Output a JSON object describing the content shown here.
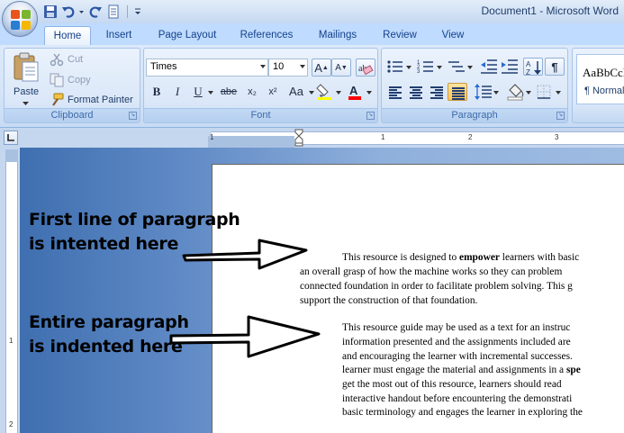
{
  "window": {
    "title": "Document1 - Microsoft Word"
  },
  "tabs": [
    {
      "label": "Home"
    },
    {
      "label": "Insert"
    },
    {
      "label": "Page Layout"
    },
    {
      "label": "References"
    },
    {
      "label": "Mailings"
    },
    {
      "label": "Review"
    },
    {
      "label": "View"
    }
  ],
  "clipboard": {
    "paste_label": "Paste",
    "cut_label": "Cut",
    "copy_label": "Copy",
    "format_painter_label": "Format Painter",
    "group_label": "Clipboard"
  },
  "font": {
    "family": "Times",
    "size": "10",
    "group_label": "Font",
    "bold": "B",
    "italic": "I",
    "underline": "U",
    "strike": "abe",
    "subscript": "x₂",
    "superscript": "x²",
    "change_case": "Aa",
    "grow": "A",
    "shrink": "A"
  },
  "paragraph": {
    "group_label": "Paragraph",
    "sort": "A↓",
    "show_marks": "¶"
  },
  "styles": {
    "preview": "AaBbCcI",
    "normal_label": "¶ Normal"
  },
  "ruler": {
    "marks": [
      "1",
      "1",
      "2",
      "3"
    ]
  },
  "vruler": {
    "marks": [
      "1",
      "2"
    ]
  },
  "callouts": {
    "first_line_1": "First line of paragraph",
    "first_line_2": "is intented here",
    "entire_1": "Entire paragraph",
    "entire_2": "is indented here"
  },
  "document": {
    "para1": {
      "line1_pre": "This resource is designed to ",
      "line1_bold": "empower",
      "line1_post": " learners with basic",
      "line2": "an overall grasp of how the machine works so they can problem",
      "line3": "connected foundation in order to facilitate problem solving. This g",
      "line4": "support the construction of that foundation."
    },
    "para2": {
      "line1": "This resource guide may be used as a text for an instruc",
      "line2": "information presented and the assignments included are",
      "line3": "and encouraging the learner with incremental successes.",
      "line4_pre": "learner must engage the material and assignments in a ",
      "line4_bold": "spe",
      "line5": "get the most out of this resource, learners should read",
      "line6": "interactive handout before encountering the demonstrati",
      "line7": "basic terminology and engages the learner in exploring the"
    }
  },
  "colors": {
    "highlight": "#ffff00",
    "font_color": "#ff0000"
  }
}
